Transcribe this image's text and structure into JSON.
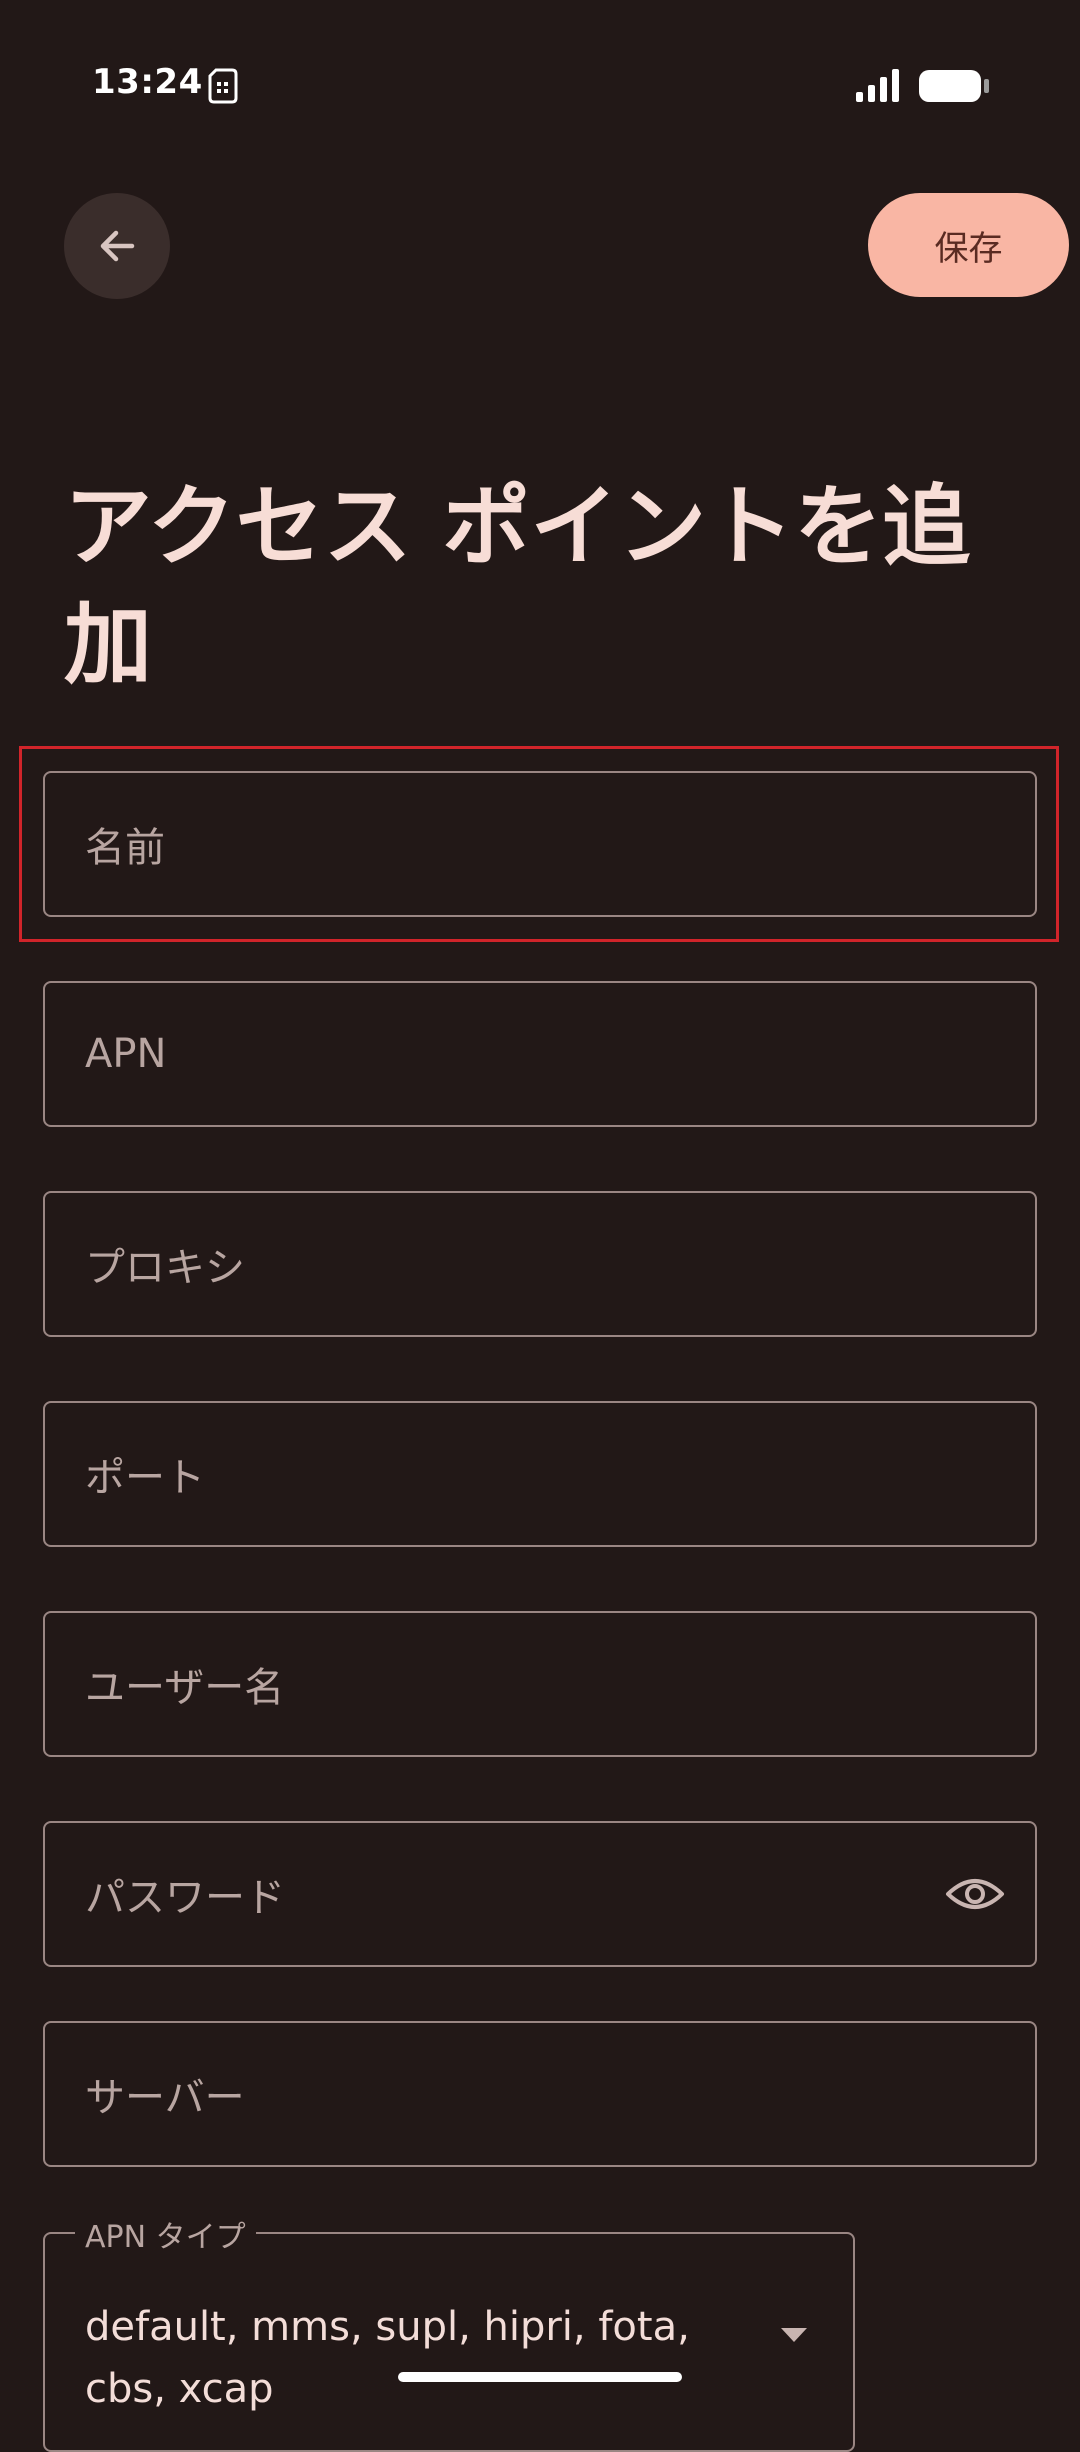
{
  "status_bar": {
    "time": "13:24",
    "icons": [
      "sim-card-icon",
      "signal-icon",
      "battery-icon"
    ]
  },
  "header": {
    "back_icon": "arrow-left-icon",
    "save_label": "保存"
  },
  "title": "アクセス ポイントを追加",
  "fields": [
    {
      "placeholder": "名前"
    },
    {
      "placeholder": "APN"
    },
    {
      "placeholder": "プロキシ"
    },
    {
      "placeholder": "ポート"
    },
    {
      "placeholder": "ユーザー名"
    },
    {
      "placeholder": "パスワード",
      "icon": "eye-icon"
    },
    {
      "placeholder": "サーバー"
    }
  ],
  "apn_type": {
    "label": "APN タイプ",
    "value": "default, mms, supl, hipri, fota, cbs, xcap",
    "icon": "dropdown-arrow-icon"
  },
  "colors": {
    "background": "#221817",
    "accent": "#f9b6a4",
    "highlight": "#d1242a",
    "outline": "#9a8683"
  }
}
